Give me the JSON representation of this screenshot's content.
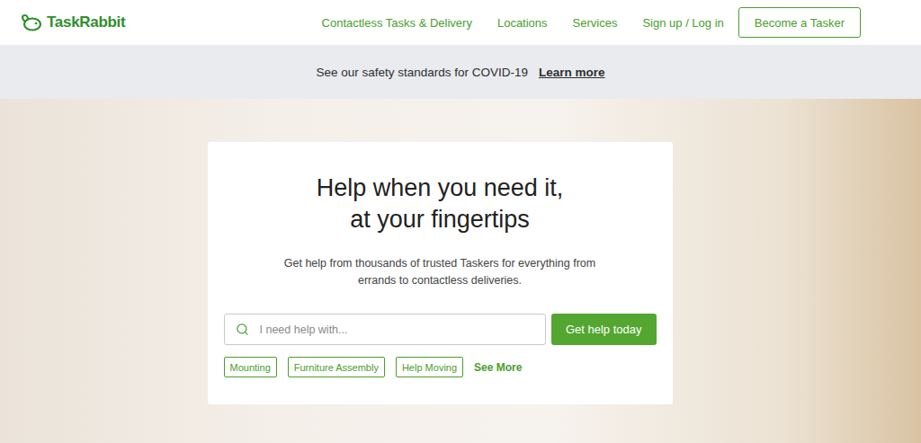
{
  "header": {
    "logo": "TaskRabbit",
    "nav": [
      "Contactless Tasks & Delivery",
      "Locations",
      "Services",
      "Sign up / Log in"
    ],
    "cta": "Become a Tasker"
  },
  "banner": {
    "text": "See our safety standards for COVID-19",
    "link": "Learn more"
  },
  "hero": {
    "title_lines": [
      "Help when you need it,",
      "at your fingertips"
    ],
    "subtitle_lines": [
      "Get help from thousands of trusted Taskers for everything from",
      "errands to contactless deliveries."
    ],
    "search": {
      "placeholder": "I need help with..."
    },
    "button": "Get help today",
    "tags": [
      "Mounting",
      "Furniture Assembly",
      "Help Moving"
    ],
    "more": "See More"
  }
}
